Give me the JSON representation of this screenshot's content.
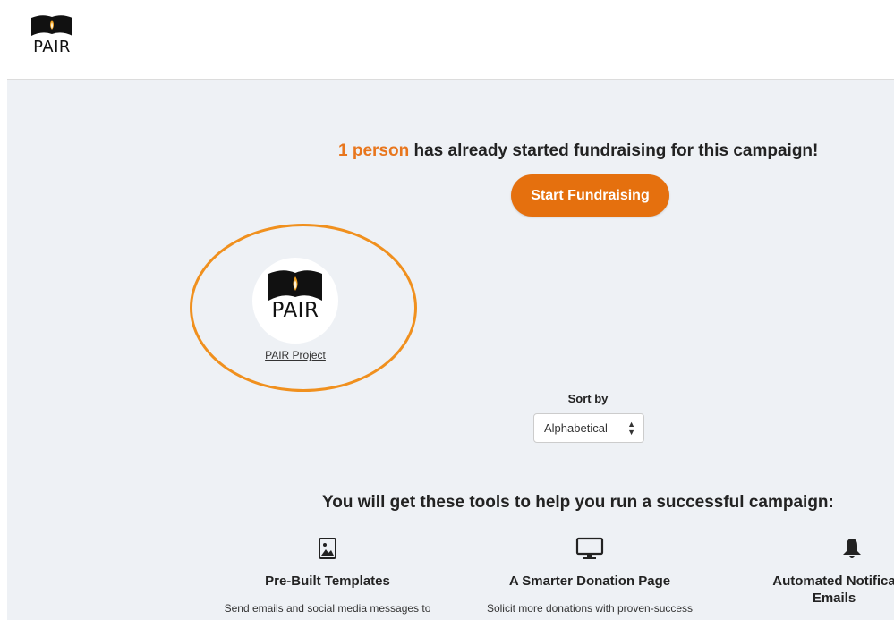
{
  "brand": {
    "logo_text": "PAIR",
    "accent": "#e5700e"
  },
  "hero": {
    "count_text": "1 person",
    "rest_text": " has already started fundraising for this campaign!",
    "start_button": "Start Fundraising"
  },
  "fundraiser": {
    "avatar_text": "PAIR",
    "name": "PAIR Project"
  },
  "sort": {
    "label": "Sort by",
    "selected": "Alphabetical"
  },
  "tools": {
    "heading": "You will get these tools to help you run a successful campaign:",
    "items": [
      {
        "icon": "image-file-icon",
        "title": "Pre-Built Templates",
        "desc": "Send emails and social media messages to"
      },
      {
        "icon": "monitor-icon",
        "title": "A Smarter Donation Page",
        "desc": "Solicit more donations with proven-success"
      },
      {
        "icon": "bell-icon",
        "title": "Automated Notifica Emails",
        "desc": ""
      }
    ]
  }
}
